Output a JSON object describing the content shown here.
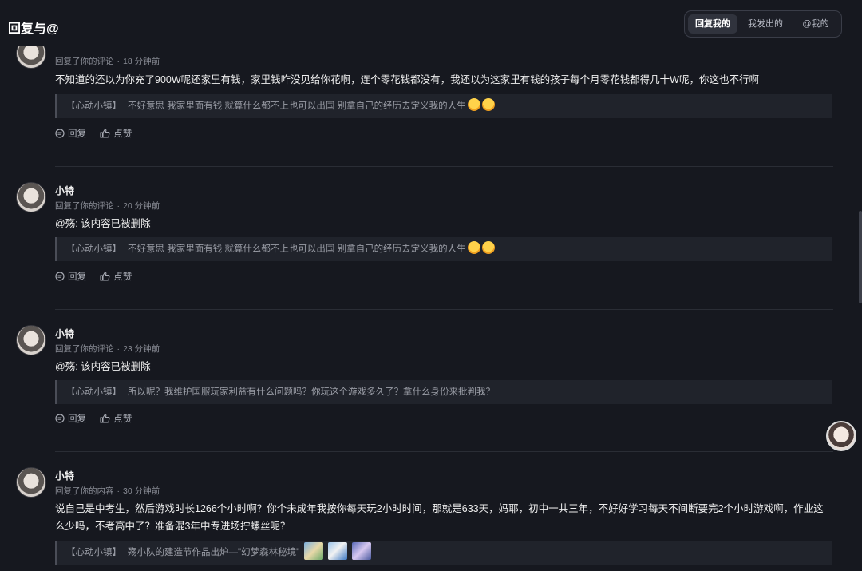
{
  "header": {
    "title": "回复与@",
    "tabs": [
      {
        "label": "回复我的",
        "active": true
      },
      {
        "label": "我发出的",
        "active": false
      },
      {
        "label": "@我的",
        "active": false
      }
    ]
  },
  "items": [
    {
      "username": "",
      "action_text": "回复了你的评论",
      "time": "18 分钟前",
      "content": "不知道的还以为你充了900W呢还家里有钱，家里钱咋没见给你花啊，连个零花钱都没有，我还以为这家里有钱的孩子每个月零花钱都得几十W呢，你这也不行啊",
      "quote_source": "【心动小镇】",
      "quote_text": "不好意思 我家里面有钱 就算什么都不上也可以出国 别拿自己的经历去定义我的人生",
      "reply_label": "回复",
      "like_label": "点赞"
    },
    {
      "username": "小特",
      "action_text": "回复了你的评论",
      "time": "20 分钟前",
      "content": "@殇: 该内容已被删除",
      "quote_source": "【心动小镇】",
      "quote_text": "不好意思 我家里面有钱 就算什么都不上也可以出国 别拿自己的经历去定义我的人生",
      "reply_label": "回复",
      "like_label": "点赞"
    },
    {
      "username": "小特",
      "action_text": "回复了你的评论",
      "time": "23 分钟前",
      "content": "@殇: 该内容已被删除",
      "quote_source": "【心动小镇】",
      "quote_text": "所以呢？我维护国服玩家利益有什么问题吗？你玩这个游戏多久了？拿什么身份来批判我？",
      "reply_label": "回复",
      "like_label": "点赞"
    },
    {
      "username": "小特",
      "action_text": "回复了你的内容",
      "time": "30 分钟前",
      "content": "说自己是中考生，然后游戏时长1266个小时啊？你个未成年我按你每天玩2小时时间，那就是633天，妈耶，初中一共三年，不好好学习每天不间断要完2个小时游戏啊，作业这么少吗，不考高中了？准备混3年中专进场拧螺丝呢？",
      "quote_source": "【心动小镇】",
      "quote_text": "殇小队的建造节作品出炉—\"幻梦森林秘境\""
    }
  ],
  "colors": {
    "background": "#16181f",
    "quote_bg": "#20232b",
    "active_tab": "#30333d"
  }
}
